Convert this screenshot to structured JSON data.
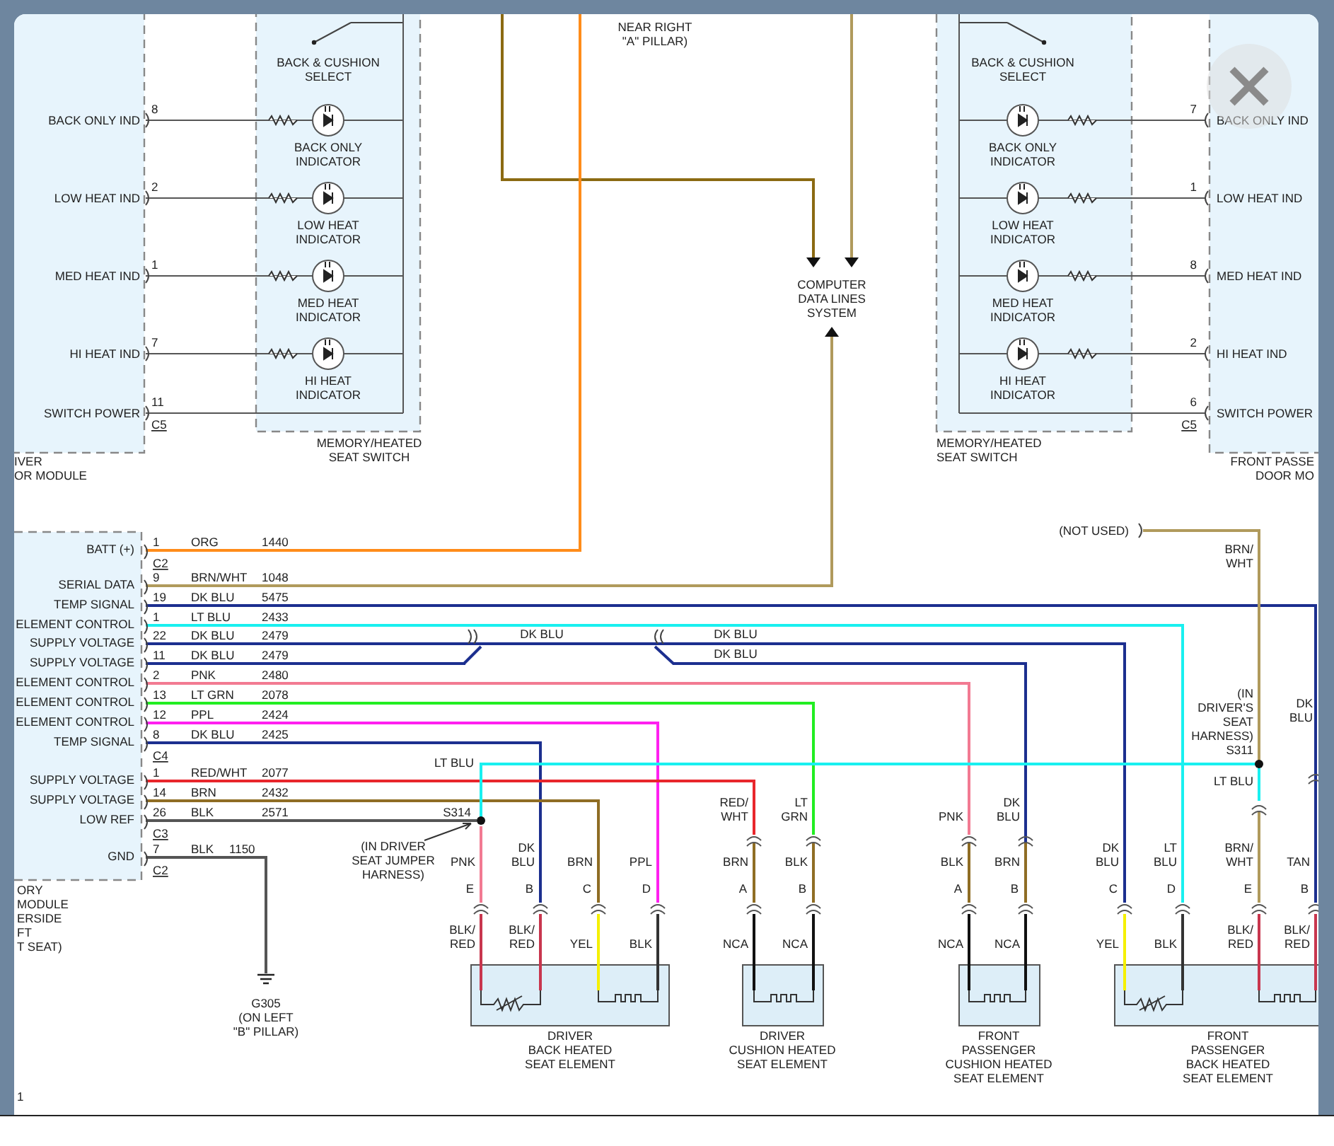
{
  "top_note": "NEAR RIGHT\n\"A\" PILLAR)",
  "data_lines": "COMPUTER\nDATA LINES\nSYSTEM",
  "switch_sides": [
    {
      "module_label": "IVER\nOR MODULE",
      "switch_label": "MEMORY/HEATED\nSEAT SWITCH",
      "select_label": "BACK & CUSHION\nSELECT",
      "connector": "C5",
      "rows": [
        {
          "signal": "BACK ONLY IND",
          "pin": "8",
          "indicator": "BACK ONLY\nINDICATOR"
        },
        {
          "signal": "LOW HEAT IND",
          "pin": "2",
          "indicator": "LOW HEAT\nINDICATOR"
        },
        {
          "signal": "MED HEAT IND",
          "pin": "1",
          "indicator": "MED HEAT\nINDICATOR"
        },
        {
          "signal": "HI HEAT IND",
          "pin": "7",
          "indicator": "HI HEAT\nINDICATOR"
        },
        {
          "signal": "SWITCH POWER",
          "pin": "11"
        }
      ]
    },
    {
      "module_label": "FRONT PASSE\nDOOR MO",
      "switch_label": "MEMORY/HEATED\nSEAT SWITCH",
      "select_label": "BACK & CUSHION\nSELECT",
      "connector": "C5",
      "rows": [
        {
          "signal": "BACK ONLY IND",
          "pin": "7",
          "indicator": "BACK ONLY\nINDICATOR"
        },
        {
          "signal": "LOW HEAT IND",
          "pin": "1",
          "indicator": "LOW HEAT\nINDICATOR"
        },
        {
          "signal": "MED HEAT IND",
          "pin": "8",
          "indicator": "MED HEAT\nINDICATOR"
        },
        {
          "signal": "HI HEAT IND",
          "pin": "2",
          "indicator": "HI HEAT\nINDICATOR"
        },
        {
          "signal": "SWITCH POWER",
          "pin": "6"
        }
      ]
    }
  ],
  "module": {
    "label": "ORY\nMODULE\nERSIDE\nFT\nT SEAT)",
    "groups": [
      {
        "connector": "C2",
        "rows": [
          {
            "signal": "BATT (+)",
            "pin": "1",
            "wire": "ORG",
            "circuit": "1440",
            "color": "#ff8c1a"
          }
        ]
      },
      {
        "connector": "C4",
        "rows": [
          {
            "signal": "SERIAL DATA",
            "pin": "9",
            "wire": "BRN/WHT",
            "circuit": "1048",
            "color": "#b09a5c"
          },
          {
            "signal": "TEMP SIGNAL",
            "pin": "19",
            "wire": "DK BLU",
            "circuit": "5475",
            "color": "#1c2f8f"
          },
          {
            "signal": "ELEMENT CONTROL",
            "pin": "1",
            "wire": "LT BLU",
            "circuit": "2433",
            "color": "#19f0f0"
          },
          {
            "signal": "SUPPLY VOLTAGE",
            "pin": "22",
            "wire": "DK BLU",
            "circuit": "2479",
            "color": "#1c2f8f"
          },
          {
            "signal": "SUPPLY VOLTAGE",
            "pin": "11",
            "wire": "DK BLU",
            "circuit": "2479",
            "color": "#1c2f8f"
          },
          {
            "signal": "ELEMENT CONTROL",
            "pin": "2",
            "wire": "PNK",
            "circuit": "2480",
            "color": "#f27a92"
          },
          {
            "signal": "ELEMENT CONTROL",
            "pin": "13",
            "wire": "LT GRN",
            "circuit": "2078",
            "color": "#22ee22"
          },
          {
            "signal": "ELEMENT CONTROL",
            "pin": "12",
            "wire": "PPL",
            "circuit": "2424",
            "color": "#ff20f0"
          },
          {
            "signal": "TEMP SIGNAL",
            "pin": "8",
            "wire": "DK BLU",
            "circuit": "2425",
            "color": "#1c2f8f"
          }
        ]
      },
      {
        "connector": "C3",
        "rows": [
          {
            "signal": "SUPPLY VOLTAGE",
            "pin": "1",
            "wire": "RED/WHT",
            "circuit": "2077",
            "color": "#e8262c"
          },
          {
            "signal": "SUPPLY VOLTAGE",
            "pin": "14",
            "wire": "BRN",
            "circuit": "2432",
            "color": "#8f6d24"
          },
          {
            "signal": "LOW REF",
            "pin": "26",
            "wire": "BLK",
            "circuit": "2571",
            "color": "#555555"
          }
        ]
      },
      {
        "connector": "C2",
        "rows": [
          {
            "signal": "GND",
            "pin": "7",
            "wire": "BLK",
            "circuit": "1150",
            "color": "#555555"
          }
        ]
      }
    ]
  },
  "wire_labels": [
    "DK BLU",
    "DK BLU",
    "DK BLU",
    "LT BLU",
    "S314",
    "(IN DRIVER\nSEAT JUMPER\nHARNESS)",
    "(NOT USED)",
    "BRN/\nWHT",
    "(IN\nDRIVER'S\nSEAT\nHARNESS)\nS311",
    "DK\nBLU",
    "LT BLU"
  ],
  "ground": "G305\n(ON LEFT\n\"B\" PILLAR)",
  "elements": [
    {
      "title": "DRIVER\nBACK HEATED\nSEAT ELEMENT",
      "kind": "back",
      "pins": [
        {
          "letter": "E",
          "above": "PNK",
          "lower": "BLK/\nRED",
          "color": "#c8364e"
        },
        {
          "letter": "B",
          "above": "DK\nBLU",
          "lower": "BLK/\nRED",
          "color": "#c8364e"
        },
        {
          "letter": "C",
          "above": "BRN",
          "lower": "YEL",
          "color": "#f5f000"
        },
        {
          "letter": "D",
          "above": "PPL",
          "lower": "BLK",
          "color": "#333333"
        }
      ]
    },
    {
      "title": "DRIVER\nCUSHION HEATED\nSEAT ELEMENT",
      "kind": "cushion",
      "pins": [
        {
          "letter": "A",
          "splice": "RED/\nWHT",
          "above": "BRN",
          "lower": "NCA",
          "color": "#111111"
        },
        {
          "letter": "B",
          "splice": "LT\nGRN",
          "above": "BLK",
          "lower": "NCA",
          "color": "#111111"
        }
      ]
    },
    {
      "title": "FRONT\nPASSENGER\nCUSHION HEATED\nSEAT ELEMENT",
      "kind": "cushion",
      "pins": [
        {
          "letter": "A",
          "splice": "PNK",
          "above": "BLK",
          "lower": "NCA",
          "color": "#111111"
        },
        {
          "letter": "B",
          "splice": "DK\nBLU",
          "above": "BRN",
          "lower": "NCA",
          "color": "#111111"
        }
      ]
    },
    {
      "title": "FRONT\nPASSENGER\nBACK HEATED\nSEAT ELEMENT",
      "kind": "back",
      "pins": [
        {
          "letter": "C",
          "above": "DK\nBLU",
          "lower": "YEL",
          "color": "#f5f000"
        },
        {
          "letter": "D",
          "above": "LT\nBLU",
          "lower": "BLK",
          "color": "#333333"
        },
        {
          "letter": "E",
          "above": "BRN/\nWHT",
          "lower": "BLK/\nRED",
          "color": "#c8364e"
        },
        {
          "letter": "B",
          "above": "TAN",
          "lower": "BLK/\nRED",
          "color": "#c8364e"
        }
      ]
    }
  ],
  "page_number": "1"
}
